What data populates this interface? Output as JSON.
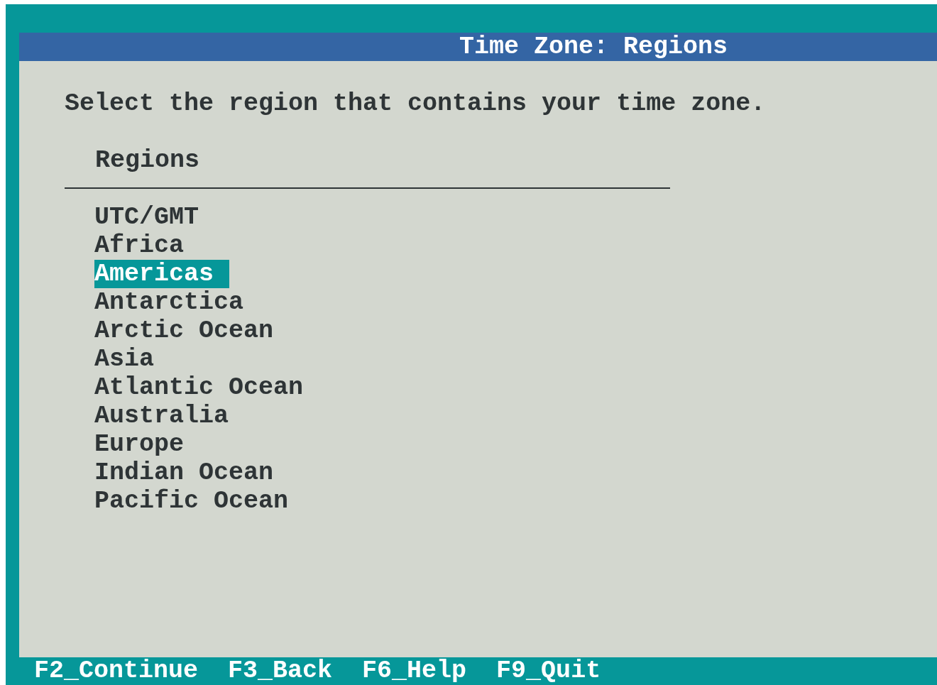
{
  "window": {
    "title": "Time Zone: Regions"
  },
  "instruction": "Select the region that contains your time zone.",
  "region_list": {
    "header": "Regions",
    "items": [
      {
        "label": "UTC/GMT",
        "selected": false
      },
      {
        "label": "Africa",
        "selected": false
      },
      {
        "label": "Americas",
        "selected": true
      },
      {
        "label": "Antarctica",
        "selected": false
      },
      {
        "label": "Arctic Ocean",
        "selected": false
      },
      {
        "label": "Asia",
        "selected": false
      },
      {
        "label": "Atlantic Ocean",
        "selected": false
      },
      {
        "label": "Australia",
        "selected": false
      },
      {
        "label": "Europe",
        "selected": false
      },
      {
        "label": "Indian Ocean",
        "selected": false
      },
      {
        "label": "Pacific Ocean",
        "selected": false
      }
    ]
  },
  "status_bar": {
    "keys": [
      "F2_Continue",
      "F3_Back",
      "F6_Help",
      "F9_Quit"
    ]
  }
}
